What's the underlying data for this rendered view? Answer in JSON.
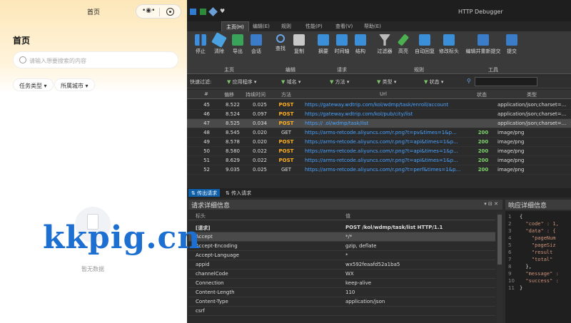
{
  "phone": {
    "nav_title": "首页",
    "heading": "首页",
    "search_placeholder": "请输入想要搜索的内容",
    "filters": [
      "任务类型",
      "所属城市"
    ],
    "empty_text": "暂无数据"
  },
  "watermark": "kkpig.cn",
  "app": {
    "title": "HTTP Debugger",
    "tabs": [
      "主页(H)",
      "编辑(E)",
      "规则",
      "性能(P)",
      "查看(V)",
      "帮助(E)"
    ],
    "ribbon": {
      "buttons": [
        "停止",
        "清除",
        "导出",
        "会话",
        "查找",
        "复制",
        "摘要",
        "时间轴",
        "结构",
        "过滤器",
        "高亮",
        "自动回复",
        "修改标头",
        "编辑并重新提交",
        "提交"
      ],
      "groups": [
        "主页",
        "编辑",
        "请求",
        "规则",
        "工具"
      ]
    },
    "filter_bar": {
      "label": "快速过滤:",
      "filters": [
        "应用程序",
        "域名",
        "方法",
        "类型",
        "状态"
      ]
    },
    "columns": [
      "#",
      "偏移",
      "持续时间",
      "方法",
      "Url",
      "状态",
      "类型"
    ],
    "rows": [
      {
        "num": "45",
        "offset": "8.522",
        "duration": "0.025",
        "method": "POST",
        "url": "https://gateway.wdtrip.com/kol/wdmp/task/enroll/account",
        "status": "",
        "type": "application/json;charset=..."
      },
      {
        "num": "46",
        "offset": "8.524",
        "duration": "0.097",
        "method": "POST",
        "url": "https://gateway.wdtrip.com/kol/pub/city/list",
        "status": "",
        "type": "application/json;charset=..."
      },
      {
        "num": "47",
        "offset": "8.525",
        "duration": "0.034",
        "method": "POST",
        "url": "https://                      .ol/wdmp/task/list",
        "status": "",
        "type": "application/json;charset=..."
      },
      {
        "num": "48",
        "offset": "8.545",
        "duration": "0.020",
        "method": "GET",
        "url": "https://arms-retcode.aliyuncs.com/r.png?t=pv&times=1&p...",
        "status": "200",
        "type": "image/png"
      },
      {
        "num": "49",
        "offset": "8.578",
        "duration": "0.020",
        "method": "POST",
        "url": "https://arms-retcode.aliyuncs.com/r.png?t=api&times=1&p...",
        "status": "200",
        "type": "image/png"
      },
      {
        "num": "50",
        "offset": "8.580",
        "duration": "0.022",
        "method": "POST",
        "url": "https://arms-retcode.aliyuncs.com/r.png?t=api&times=1&p...",
        "status": "200",
        "type": "image/png"
      },
      {
        "num": "51",
        "offset": "8.629",
        "duration": "0.022",
        "method": "POST",
        "url": "https://arms-retcode.aliyuncs.com/r.png?t=api&times=1&p...",
        "status": "200",
        "type": "image/png"
      },
      {
        "num": "52",
        "offset": "9.035",
        "duration": "0.025",
        "method": "GET",
        "url": "https://arms-retcode.aliyuncs.com/r.png?t=perf&times=1&p...",
        "status": "200",
        "type": "image/png"
      }
    ],
    "bottom_tabs": [
      "传出请求",
      "传入请求"
    ],
    "request_panel": {
      "title": "请求详细信息",
      "col_name": "标头",
      "col_value": "值",
      "rows": [
        {
          "k": "[请求]",
          "v": "POST /kol/wdmp/task/list HTTP/1.1"
        },
        {
          "k": "Accept",
          "v": "*/*"
        },
        {
          "k": "Accept-Encoding",
          "v": "gzip, deflate"
        },
        {
          "k": "Accept-Language",
          "v": "*"
        },
        {
          "k": "appid",
          "v": "wx592feaafd52a1ba5"
        },
        {
          "k": "channelCode",
          "v": "WX"
        },
        {
          "k": "Connection",
          "v": "keep-alive"
        },
        {
          "k": "Content-Length",
          "v": "110"
        },
        {
          "k": "Content-Type",
          "v": "application/json"
        },
        {
          "k": "csrf",
          "v": ""
        }
      ]
    },
    "response_panel": {
      "title": "响应详细信息",
      "line_numbers": [
        "1",
        "2",
        "3",
        "4",
        "5",
        "6",
        "7",
        "8",
        "9",
        "10",
        "11"
      ],
      "lines": [
        "{",
        "  \"code\" : 1,",
        "  \"data\" : {",
        "    \"pageNum",
        "    \"pageSiz",
        "    \"result",
        "    \"total\"",
        "  },",
        "  \"message\" :",
        "  \"success\" :",
        "}"
      ]
    }
  }
}
